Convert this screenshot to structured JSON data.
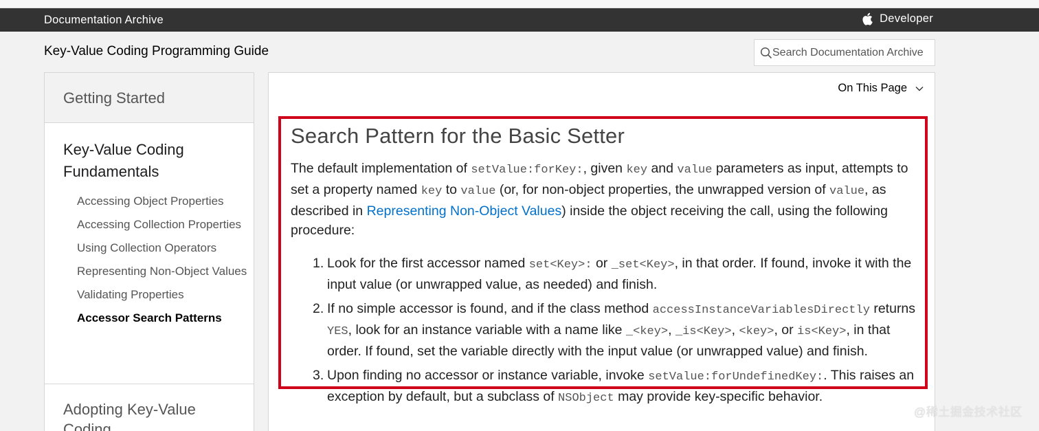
{
  "header": {
    "archive_title": "Documentation Archive",
    "developer_label": "Developer",
    "icons": [
      "apple-logo-icon"
    ]
  },
  "guide": {
    "title": "Key-Value Coding Programming Guide"
  },
  "search": {
    "placeholder": "Search Documentation Archive"
  },
  "sidebar": {
    "sections": [
      {
        "label": "Getting Started"
      },
      {
        "label": "Key-Value Coding Fundamentals"
      },
      {
        "label": "Adopting Key-Value Coding"
      }
    ],
    "items": [
      {
        "label": "Accessing Object Properties"
      },
      {
        "label": "Accessing Collection Properties"
      },
      {
        "label": "Using Collection Operators"
      },
      {
        "label": "Representing Non-Object Values"
      },
      {
        "label": "Validating Properties"
      },
      {
        "label": "Accessor Search Patterns",
        "active": true
      }
    ]
  },
  "on_this_page": {
    "label": "On This Page"
  },
  "article": {
    "heading": "Search Pattern for the Basic Setter",
    "intro": {
      "t1": "The default implementation of ",
      "c1": "setValue:forKey:",
      "t2": ", given ",
      "c2": "key",
      "t3": " and ",
      "c3": "value",
      "t4": " parameters as input, attempts to set a property named ",
      "c4": "key",
      "t5": " to ",
      "c5": "value",
      "t6": " (or, for non-object properties, the unwrapped version of ",
      "c6": "value",
      "t7": ", as described in ",
      "link": "Representing Non-Object Values",
      "t8": ") inside the object receiving the call, using the following procedure:"
    },
    "steps": [
      {
        "num": "1.",
        "t1": "Look for the first accessor named ",
        "c1": "set<Key>:",
        "t2": " or ",
        "c2": "_set<Key>",
        "t3": ", in that order. If found, invoke it with the input value (or unwrapped value, as needed) and finish."
      },
      {
        "num": "2.",
        "t1": "If no simple accessor is found, and if the class method ",
        "c1": "accessInstanceVariablesDirectly",
        "t2": " returns ",
        "c2": "YES",
        "t3": ", look for an instance variable with a name like ",
        "c3": "_<key>",
        "t4": ", ",
        "c4": "_is<Key>",
        "t5": ", ",
        "c5": "<key>",
        "t6": ", or ",
        "c6": "is<Key>",
        "t7": ", in that order. If found, set the variable directly with the input value (or unwrapped value) and finish."
      },
      {
        "num": "3.",
        "t1": "Upon finding no accessor or instance variable, invoke ",
        "c1": "setValue:forUndefinedKey:",
        "t2": ". This raises an exception by default, but a subclass of ",
        "c2": "NSObject",
        "t3": " may provide key-specific behavior."
      }
    ]
  },
  "colors": {
    "topbar": "#333333",
    "link": "#0070c9",
    "highlight": "#d0021b"
  },
  "watermark": "@稀土掘金技术社区"
}
